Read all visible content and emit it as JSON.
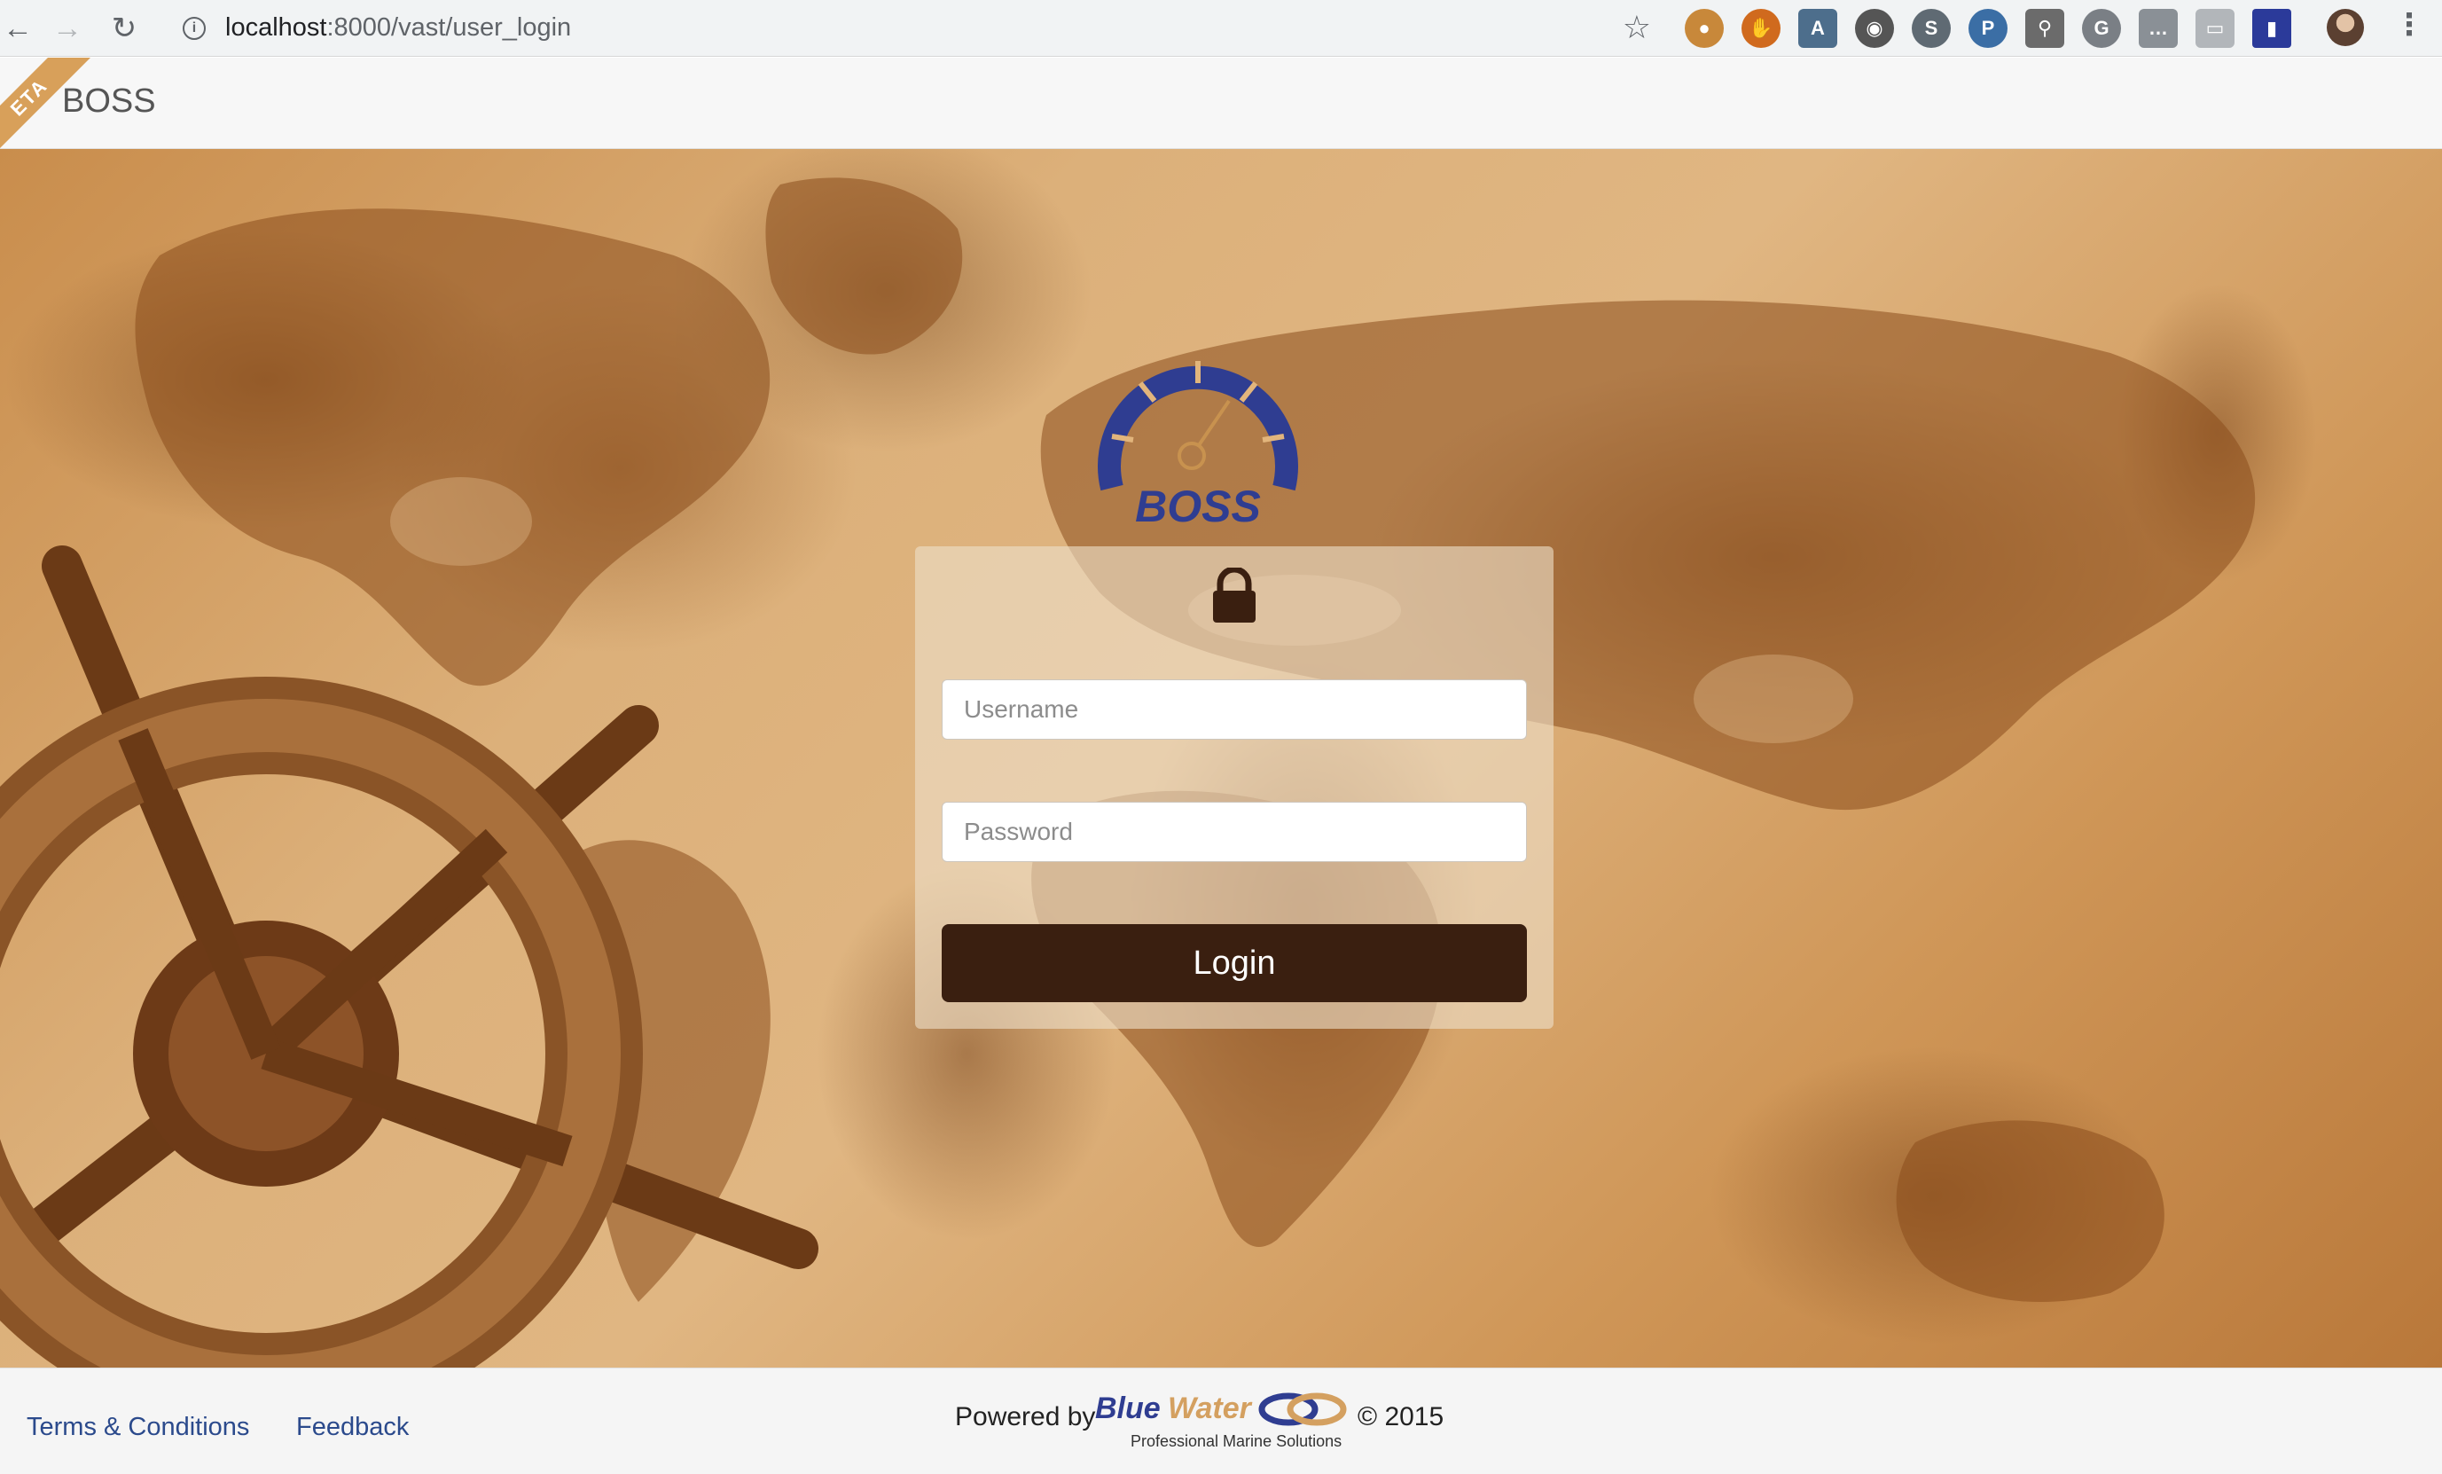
{
  "browser": {
    "url_host": "localhost",
    "url_path": ":8000/vast/user_login",
    "extensions": [
      "cookie-icon",
      "hand-icon",
      "document-icon",
      "eye-icon",
      "skype-icon",
      "python-icon",
      "microscope-icon",
      "grammarly-icon",
      "translate-icon",
      "screen-icon",
      "book-icon"
    ]
  },
  "app": {
    "beta_ribbon": "ETA",
    "brand": "BOSS",
    "logo_text": "BOSS"
  },
  "login": {
    "username_placeholder": "Username",
    "password_placeholder": "Password",
    "login_label": "Login"
  },
  "footer": {
    "terms": "Terms & Conditions",
    "feedback": "Feedback",
    "powered_by": "Powered by",
    "brand_blue": "Blue",
    "brand_water": "Water",
    "tagline": "Professional Marine Solutions",
    "copyright": "© 2015"
  },
  "colors": {
    "login_button": "#3a1f10",
    "logo_blue": "#2f3d91",
    "accent_tan": "#d4a060"
  }
}
